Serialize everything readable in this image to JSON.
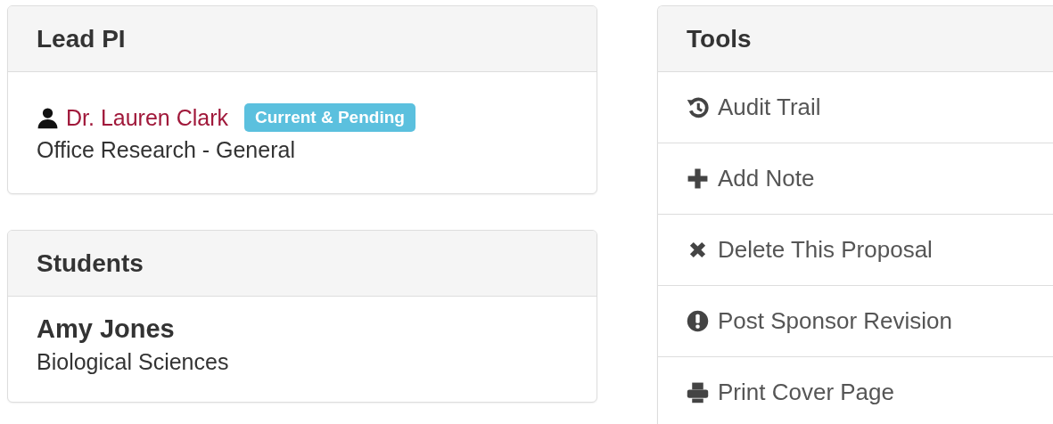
{
  "lead_pi": {
    "title": "Lead PI",
    "name": "Dr. Lauren Clark",
    "badge": "Current & Pending",
    "department": "Office Research - General"
  },
  "students": {
    "title": "Students",
    "items": [
      {
        "name": "Amy Jones",
        "department": "Biological Sciences"
      }
    ]
  },
  "tools": {
    "title": "Tools",
    "items": [
      {
        "kind": "history",
        "label": "Audit Trail"
      },
      {
        "kind": "add",
        "label": "Add Note"
      },
      {
        "kind": "delete",
        "label": "Delete This Proposal"
      },
      {
        "kind": "alert",
        "label": "Post Sponsor Revision"
      },
      {
        "kind": "print",
        "label": "Print Cover Page"
      }
    ]
  }
}
